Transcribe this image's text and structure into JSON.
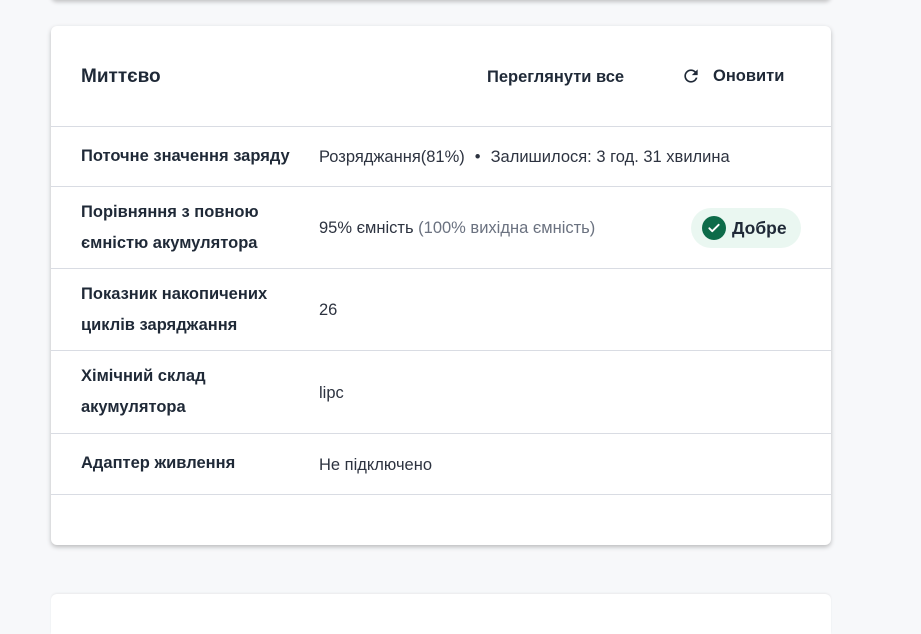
{
  "card": {
    "title": "Миттєво",
    "view_all": "Переглянути все",
    "refresh": "Оновити"
  },
  "rows": {
    "charge": {
      "label": "Поточне значення заряду",
      "status": "Розряджання(81%)",
      "separator": "•",
      "remaining": "Залишилося: 3 год. 31 хвилина"
    },
    "capacity": {
      "label": "Порівняння з повною ємністю акумулятора",
      "value": "95% ємність",
      "detail": "(100% вихідна ємність)",
      "badge": "Добре",
      "badge_color": "#0d6b49"
    },
    "cycles": {
      "label": "Показник накопичених циклів заряджання",
      "value": "26"
    },
    "chemistry": {
      "label": "Хімічний склад акумулятора",
      "value": "lipc"
    },
    "adapter": {
      "label": "Адаптер живлення",
      "value": "Не підключено"
    }
  },
  "icons": {
    "refresh": "refresh-icon",
    "check": "check-circle-icon"
  }
}
